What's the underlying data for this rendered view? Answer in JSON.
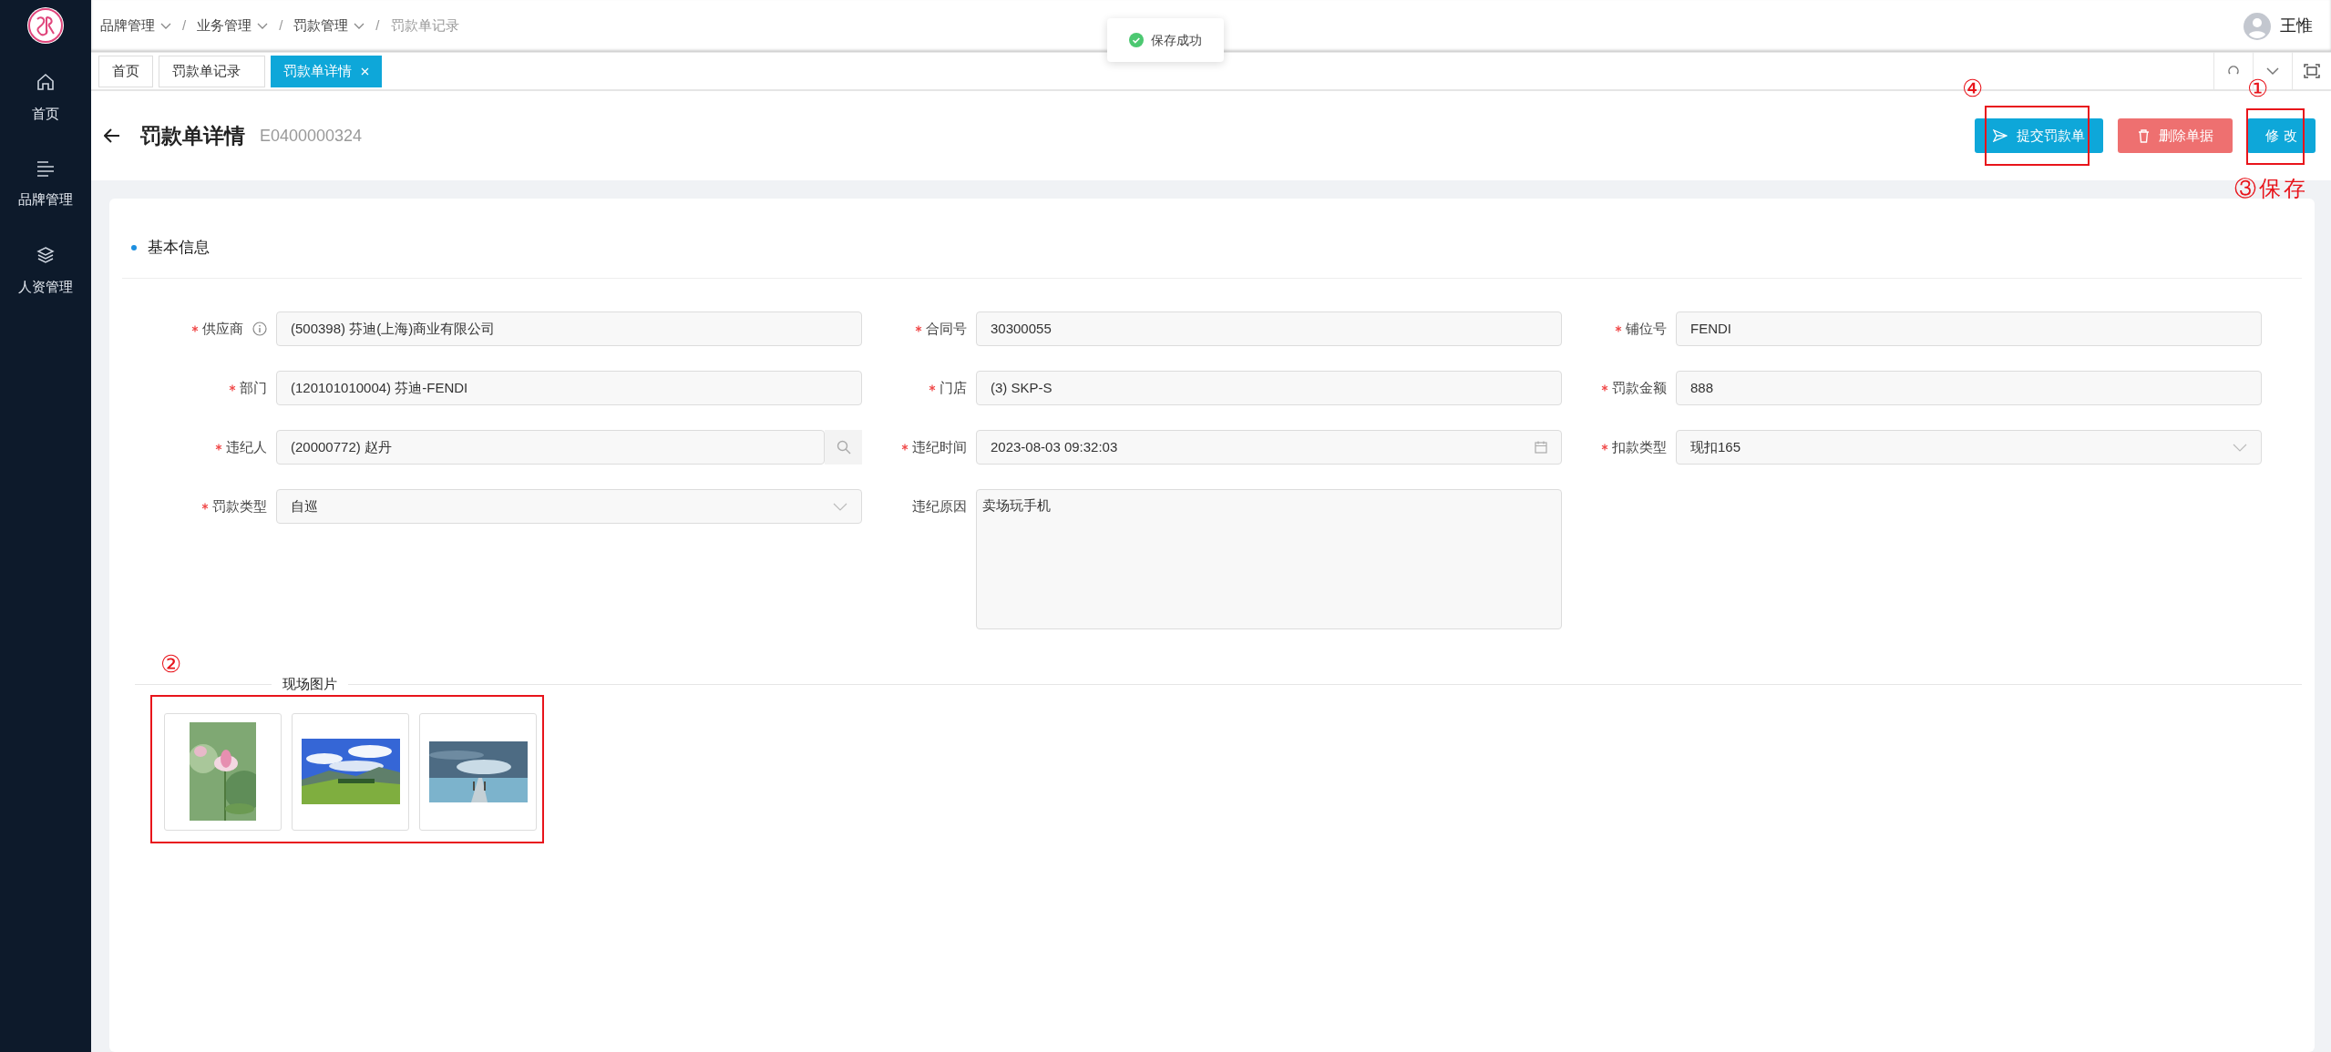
{
  "sidebar": {
    "items": [
      {
        "label": "首页",
        "kind": "home"
      },
      {
        "label": "品牌管理",
        "kind": "list"
      },
      {
        "label": "人资管理",
        "kind": "layers"
      }
    ]
  },
  "breadcrumb": [
    {
      "kind": "link",
      "label": "品牌管理",
      "dropdown": true,
      "current": false
    },
    {
      "kind": "separator",
      "label": "/"
    },
    {
      "kind": "link",
      "label": "业务管理",
      "dropdown": true,
      "current": false
    },
    {
      "kind": "separator",
      "label": "/"
    },
    {
      "kind": "link",
      "label": "罚款管理",
      "dropdown": true,
      "current": false
    },
    {
      "kind": "separator",
      "label": "/"
    },
    {
      "kind": "link",
      "label": "罚款单记录",
      "dropdown": false,
      "current": true
    }
  ],
  "toast": {
    "text": "保存成功"
  },
  "user": {
    "name": "王惟"
  },
  "tabs": [
    {
      "label": "首页",
      "selected": false,
      "closable": false
    },
    {
      "label": "罚款单记录",
      "selected": false,
      "closable": false
    },
    {
      "label": "罚款单详情",
      "selected": true,
      "closable": true
    }
  ],
  "page": {
    "title": "罚款单详情",
    "code": "E0400000324"
  },
  "actions": [
    {
      "label": "提交罚款单",
      "kind": "submit"
    },
    {
      "label": "删除单据",
      "kind": "delete"
    },
    {
      "label": "修 改",
      "kind": "edit"
    }
  ],
  "section": {
    "title": "基本信息"
  },
  "fields": [
    {
      "label": "供应商",
      "value": "(500398) 芬迪(上海)商业有限公司",
      "required": true,
      "info": true,
      "kind": "text"
    },
    {
      "label": "合同号",
      "value": "30300055",
      "required": true,
      "info": false,
      "kind": "text"
    },
    {
      "label": "铺位号",
      "value": "FENDI",
      "required": true,
      "info": false,
      "kind": "text"
    },
    {
      "label": "部门",
      "value": "(120101010004) 芬迪-FENDI",
      "required": true,
      "info": false,
      "kind": "text"
    },
    {
      "label": "门店",
      "value": "(3) SKP-S",
      "required": true,
      "info": false,
      "kind": "text"
    },
    {
      "label": "罚款金额",
      "value": "888",
      "required": true,
      "info": false,
      "kind": "text"
    },
    {
      "label": "违纪人",
      "value": "(20000772) 赵丹",
      "required": true,
      "info": false,
      "kind": "search"
    },
    {
      "label": "违纪时间",
      "value": "2023-08-03 09:32:03",
      "required": true,
      "info": false,
      "kind": "date"
    },
    {
      "label": "扣款类型",
      "value": "现扣165",
      "required": true,
      "info": false,
      "kind": "select"
    },
    {
      "label": "罚款类型",
      "value": "自巡",
      "required": true,
      "info": false,
      "kind": "select"
    },
    {
      "label": "违纪原因",
      "value": "卖场玩手机",
      "required": false,
      "info": false,
      "kind": "textarea"
    }
  ],
  "photos": {
    "title": "现场图片"
  },
  "annotations": [
    {
      "text": "④",
      "kind": "submit"
    },
    {
      "text": "①",
      "kind": "edit"
    },
    {
      "text": "③保存",
      "kind": "save"
    },
    {
      "text": "②",
      "kind": "photos"
    }
  ]
}
